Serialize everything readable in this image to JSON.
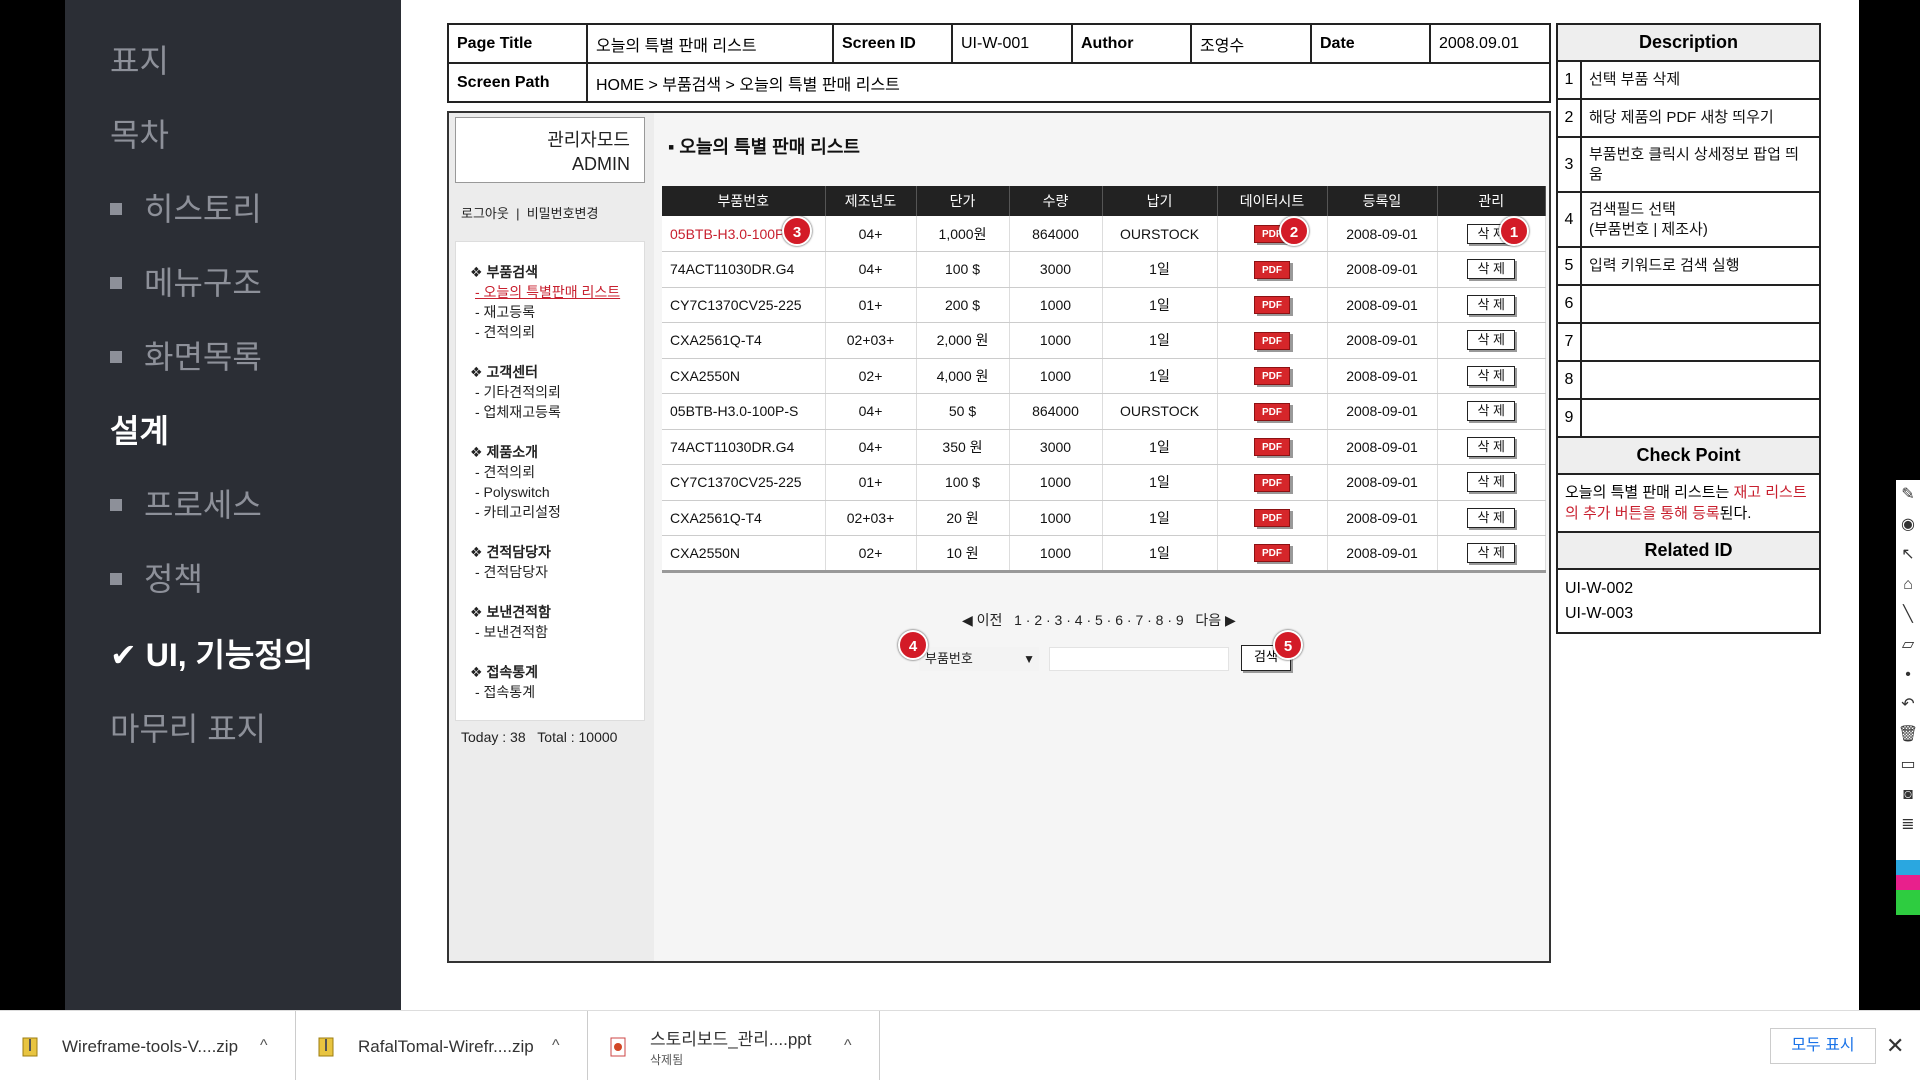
{
  "sidebar": {
    "items": [
      {
        "label": "표지",
        "bullet": false,
        "bold": false
      },
      {
        "label": "목차",
        "bullet": false,
        "bold": false
      },
      {
        "label": "히스토리",
        "bullet": true,
        "bold": false
      },
      {
        "label": "메뉴구조",
        "bullet": true,
        "bold": false
      },
      {
        "label": "화면목록",
        "bullet": true,
        "bold": false
      },
      {
        "label": "설계",
        "bullet": false,
        "bold": true
      },
      {
        "label": "프로세스",
        "bullet": true,
        "bold": false
      },
      {
        "label": "정책",
        "bullet": true,
        "bold": false
      },
      {
        "label": "✔ UI, 기능정의",
        "bullet": false,
        "bold": true
      },
      {
        "label": "마무리 표지",
        "bullet": false,
        "bold": false
      }
    ]
  },
  "header": {
    "page_title_label": "Page Title",
    "page_title": "오늘의 특별 판매 리스트",
    "screen_id_label": "Screen ID",
    "screen_id": "UI-W-001",
    "author_label": "Author",
    "author": "조영수",
    "date_label": "Date",
    "date": "2008.09.01",
    "screen_path_label": "Screen Path",
    "screen_path": "HOME > 부품검색 > 오늘의 특별 판매 리스트"
  },
  "admin": {
    "mode_line1": "관리자모드",
    "mode_line2": "ADMIN",
    "logout": "로그아웃",
    "change_password": "비밀번호변경",
    "separator": "|"
  },
  "menu": [
    {
      "group": "❖ 부품검색",
      "items": [
        "- 오늘의 특별판매 리스트",
        "- 재고등록",
        "- 견적의뢰"
      ],
      "active": 0
    },
    {
      "group": "❖ 고객센터",
      "items": [
        "- 기타견적의뢰",
        "- 업체재고등록"
      ],
      "active": -1
    },
    {
      "group": "❖ 제품소개",
      "items": [
        "- 견적의뢰",
        "- Polyswitch",
        "- 카테고리설정"
      ],
      "active": -1
    },
    {
      "group": "❖ 견적담당자",
      "items": [
        "- 견적담당자"
      ],
      "active": -1
    },
    {
      "group": "❖ 보낸견적함",
      "items": [
        "- 보낸견적함"
      ],
      "active": -1
    },
    {
      "group": "❖ 접속통계",
      "items": [
        "- 접속통계"
      ],
      "active": -1
    }
  ],
  "stats": {
    "today": "Today : 38",
    "total": "Total : 10000"
  },
  "list": {
    "title": "▪ 오늘의 특별 판매 리스트",
    "columns": [
      "부품번호",
      "제조년도",
      "단가",
      "수량",
      "납기",
      "데이터시트",
      "등록일",
      "관리"
    ],
    "rows": [
      [
        "05BTB-H3.0-100P",
        "04+",
        "1,000원",
        "864000",
        "OURSTOCK",
        "PDF",
        "2008-09-01",
        "삭 제"
      ],
      [
        "74ACT11030DR.G4",
        "04+",
        "100 $",
        "3000",
        "1일",
        "PDF",
        "2008-09-01",
        "삭 제"
      ],
      [
        "CY7C1370CV25-225",
        "01+",
        "200 $",
        "1000",
        "1일",
        "PDF",
        "2008-09-01",
        "삭 제"
      ],
      [
        "CXA2561Q-T4",
        "02+03+",
        "2,000 원",
        "1000",
        "1일",
        "PDF",
        "2008-09-01",
        "삭 제"
      ],
      [
        "CXA2550N",
        "02+",
        "4,000 원",
        "1000",
        "1일",
        "PDF",
        "2008-09-01",
        "삭 제"
      ],
      [
        "05BTB-H3.0-100P-S",
        "04+",
        "50 $",
        "864000",
        "OURSTOCK",
        "PDF",
        "2008-09-01",
        "삭 제"
      ],
      [
        "74ACT11030DR.G4",
        "04+",
        "350 원",
        "3000",
        "1일",
        "PDF",
        "2008-09-01",
        "삭 제"
      ],
      [
        "CY7C1370CV25-225",
        "01+",
        "100 $",
        "1000",
        "1일",
        "PDF",
        "2008-09-01",
        "삭 제"
      ],
      [
        "CXA2561Q-T4",
        "02+03+",
        "20 원",
        "1000",
        "1일",
        "PDF",
        "2008-09-01",
        "삭 제"
      ],
      [
        "CXA2550N",
        "02+",
        "10 원",
        "1000",
        "1일",
        "PDF",
        "2008-09-01",
        "삭 제"
      ]
    ],
    "highlight_row": 0
  },
  "pager": {
    "prev": "◀ 이전",
    "pages": "1 · 2 · 3 · 4 · 5 · 6 · 7 · 8 · 9",
    "next": "다음 ▶"
  },
  "search": {
    "field_value": "부품번호",
    "arrow": "▼",
    "button": "검색",
    "input_value": ""
  },
  "badges": [
    "1",
    "2",
    "3",
    "4",
    "5"
  ],
  "description": {
    "title": "Description",
    "items": [
      {
        "num": "1",
        "text": "선택 부품 삭제"
      },
      {
        "num": "2",
        "text": "해당 제품의 PDF 새창 띄우기"
      },
      {
        "num": "3",
        "text": "부품번호 클릭시 상세정보 팝업 띄움"
      },
      {
        "num": "4",
        "text": "검색필드 선택\n(부품번호 | 제조사)"
      },
      {
        "num": "5",
        "text": "입력 키워드로 검색 실행"
      },
      {
        "num": "6",
        "text": ""
      },
      {
        "num": "7",
        "text": ""
      },
      {
        "num": "8",
        "text": ""
      },
      {
        "num": "9",
        "text": ""
      }
    ],
    "check_point_title": "Check Point",
    "check_point_pre": "오늘의 특별 판매 리스트는 ",
    "check_point_red": "재고 리스트의 추가 버튼을 통해 등록",
    "check_point_post": "된다.",
    "related_title": "Related ID",
    "related": [
      "UI-W-002",
      "UI-W-003"
    ]
  },
  "downloads": [
    {
      "name": "Wireframe-tools-V....zip",
      "sub": ""
    },
    {
      "name": "RafalTomal-Wirefr....zip",
      "sub": ""
    },
    {
      "name": "스토리보드_관리....ppt",
      "sub": "삭제됨"
    }
  ],
  "download_bar": {
    "show_all": "모두 표시",
    "close": "✕",
    "chevron": "^"
  },
  "colors": {
    "accent_red": "#c8202f",
    "sidebar_bg": "#2b2e35",
    "link_blue": "#1a73e8"
  }
}
